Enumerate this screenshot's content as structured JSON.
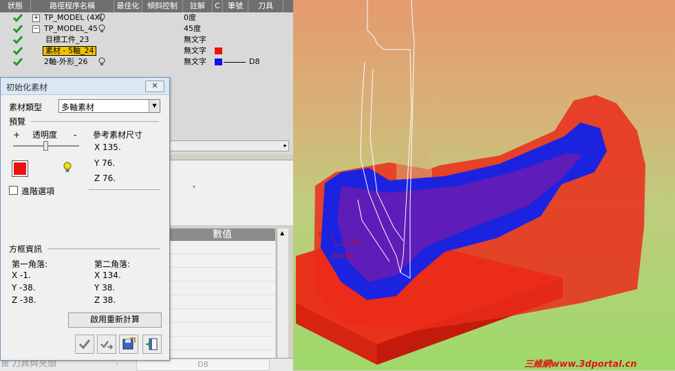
{
  "tree": {
    "headers": [
      "狀態",
      "路徑程序名稱",
      "最佳化",
      "傾斜控制",
      "註解",
      "C",
      "筆號",
      "刀具"
    ],
    "rows": [
      {
        "label": "TP_MODEL (4X(",
        "value": "0度",
        "expander": "+"
      },
      {
        "label": "TP_MODEL_45",
        "value": "45度",
        "expander": "−"
      },
      {
        "label": "目標工件_23",
        "value": "無文字"
      },
      {
        "label": "素材 - 5軸_24",
        "value": "無文字",
        "swatch": "#ee1111"
      },
      {
        "label": "2軸-外形_26",
        "value": "無文字",
        "swatch": "#1111ee",
        "tool": "D8"
      }
    ]
  },
  "lower": {
    "grid_header": "數值",
    "bottom_label": "⊞ 刀具與夾頭",
    "bottom_dash": "-",
    "bottom_tool": "D8"
  },
  "dialog": {
    "title": "初始化素材",
    "close": "✕",
    "stock_type_label": "素材類型",
    "stock_type_value": "多軸素材",
    "preview_label": "預覽",
    "plus": "+",
    "transparency_label": "透明度",
    "minus": "-",
    "ref_size_label": "參考素材尺寸",
    "ref_x": "X  135.",
    "ref_y": "Y  76.",
    "ref_z": "Z  76.",
    "advanced_label": "進階選項",
    "box_info_label": "方框資訊",
    "corner1_label": "第一角落:",
    "corner1_x": "X  -1.",
    "corner1_y": "Y  -38.",
    "corner1_z": "Z  -38.",
    "corner2_label": "第二角落:",
    "corner2_x": "X  134.",
    "corner2_y": "Y  38.",
    "corner2_z": "Z  38.",
    "recalc_button": "啟用重新計算",
    "stock_color": "#ee1111"
  },
  "viewport": {
    "axis_model_label": "MODEL",
    "axis_x": "X",
    "axis_y": "Y",
    "watermark": "三維網www.3dportal.cn"
  }
}
